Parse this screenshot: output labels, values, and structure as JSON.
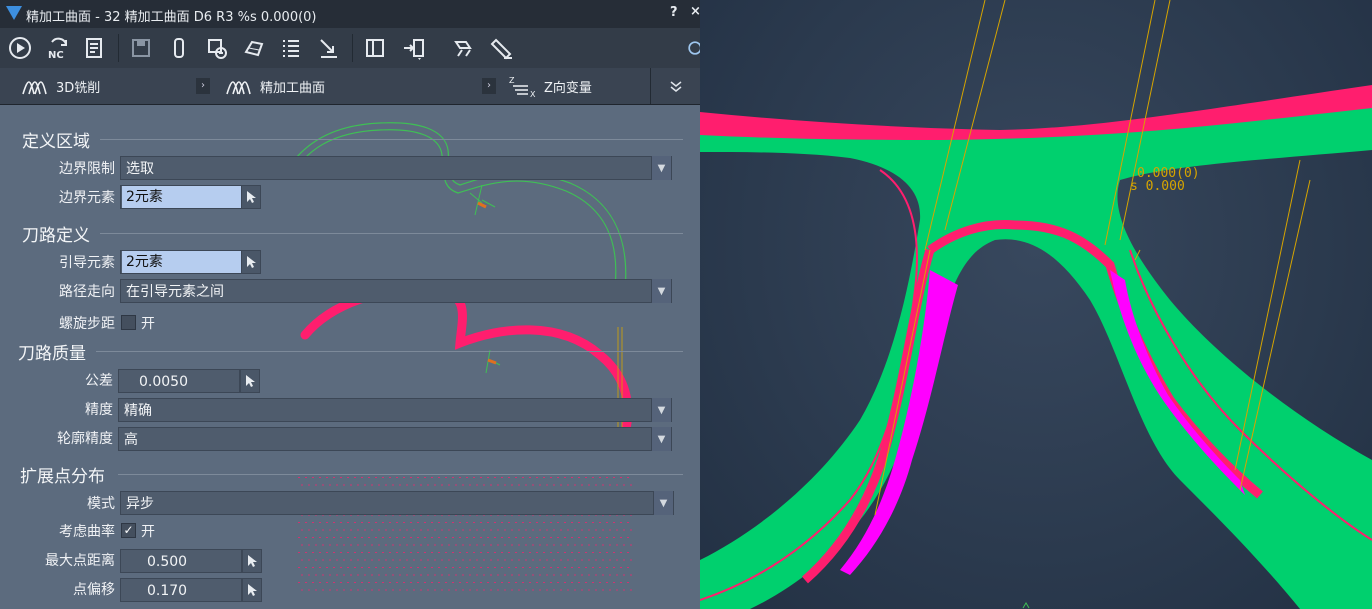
{
  "window": {
    "title": "精加工曲面 - 32 精加工曲面 D6 R3 %s 0.000(0)",
    "help": "?",
    "close": "×"
  },
  "toolbar": {
    "icons": [
      "play-icon",
      "nc-refresh-icon",
      "nc-program-icon",
      "save-icon",
      "stock-icon",
      "machine-icon",
      "surface-icon",
      "list-icon",
      "arrow-tool-icon",
      "panel-icon",
      "import-menu-icon",
      "link-icon",
      "eraser-icon",
      "viewport-icon"
    ],
    "nc_label": "NC"
  },
  "breadcrumb": {
    "items": [
      {
        "label": "3D铣削",
        "icon": "milling-3d-icon"
      },
      {
        "label": "精加工曲面",
        "icon": "surface-finish-icon"
      },
      {
        "label": "Z向变量",
        "icon": "z-variable-icon"
      }
    ],
    "z_icon_super": "Z",
    "z_icon_sub": "X"
  },
  "sections": {
    "define_area": "定义区域",
    "path_define": "刀路定义",
    "path_quality": "刀路质量",
    "extend_points": "扩展点分布"
  },
  "fields": {
    "boundary_limit": {
      "label": "边界限制",
      "value": "选取"
    },
    "boundary_elem": {
      "label": "边界元素",
      "value": "2元素"
    },
    "guide_elem": {
      "label": "引导元素",
      "value": "2元素"
    },
    "path_direction": {
      "label": "路径走向",
      "value": "在引导元素之间"
    },
    "spiral_step": {
      "label": "螺旋步距",
      "checked": false,
      "text": "开"
    },
    "tolerance": {
      "label": "公差",
      "value": "0.0050"
    },
    "precision": {
      "label": "精度",
      "value": "精确"
    },
    "contour_precision": {
      "label": "轮廓精度",
      "value": "高"
    },
    "mode": {
      "label": "模式",
      "value": "异步"
    },
    "consider_curvature": {
      "label": "考虑曲率",
      "checked": true,
      "text": "开"
    },
    "max_point_distance": {
      "label": "最大点距离",
      "value": "0.500"
    },
    "point_offset": {
      "label": "点偏移",
      "value": "0.170"
    }
  },
  "viewport": {
    "readout_1": "0.000(0)",
    "readout_2": "s 0.000"
  },
  "colors": {
    "accent_blue": "#3d8fe0",
    "highlight": "#b6cdef",
    "red_path": "#ff1e6e",
    "green_region": "#00d06e",
    "magenta": "#ff00ff",
    "guide_yellow": "#d6a400"
  }
}
